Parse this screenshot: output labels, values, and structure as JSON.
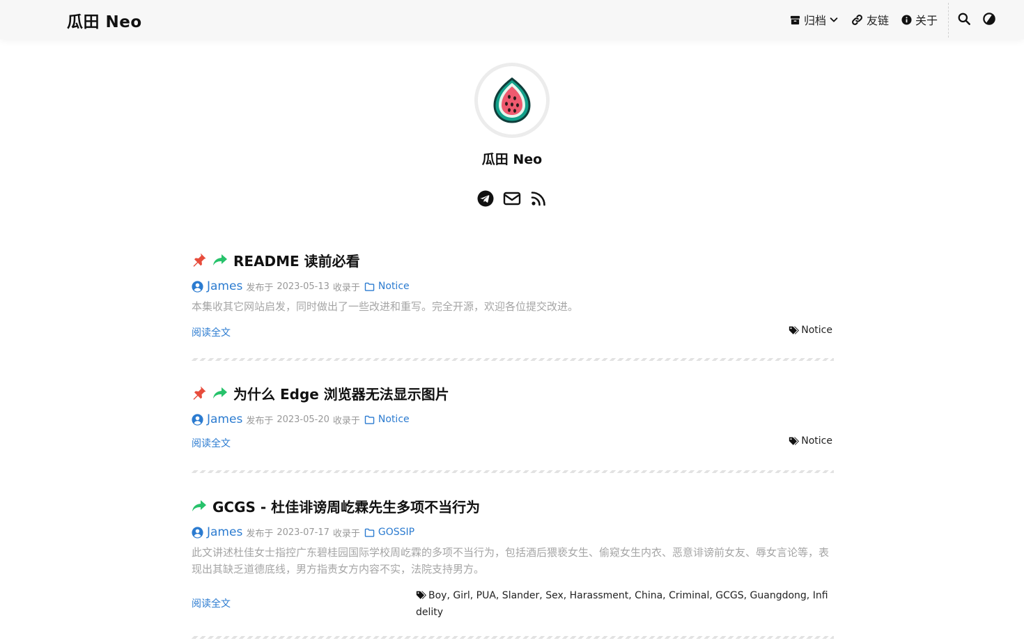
{
  "site": {
    "title": "瓜田 Neo"
  },
  "nav": {
    "archive": "归档",
    "links": "友链",
    "about": "关于"
  },
  "profile": {
    "name": "瓜田 Neo"
  },
  "colors": {
    "accent": "#2b7bd0",
    "pin": "#e74c3c",
    "share": "#27c26b",
    "muted": "#999999"
  },
  "posts": [
    {
      "title": "README 读前必看",
      "author": "James",
      "published_prefix": "发布于",
      "date": "2023-05-13",
      "filed_prefix": "收录于",
      "category": "Notice",
      "excerpt": "本集收其它网站启发，同时做出了一些改进和重写。完全开源，欢迎各位提交改进。",
      "read_more": "阅读全文",
      "tags": "Notice"
    },
    {
      "title": "为什么 Edge 浏览器无法显示图片",
      "author": "James",
      "published_prefix": "发布于",
      "date": "2023-05-20",
      "filed_prefix": "收录于",
      "category": "Notice",
      "read_more": "阅读全文",
      "tags": "Notice"
    },
    {
      "title": "GCGS - 杜佳诽谤周屹霖先生多项不当行为",
      "author": "James",
      "published_prefix": "发布于",
      "date": "2023-07-17",
      "filed_prefix": "收录于",
      "category": "GOSSIP",
      "excerpt": "此文讲述杜佳女士指控广东碧桂园国际学校周屹霖的多项不当行为，包括酒后猥亵女生、偷窥女生内衣、恶意诽谤前女友、辱女言论等，表现出其缺乏道德底线，男方指责女方内容不实，法院支持男方。",
      "read_more": "阅读全文",
      "tags": "Boy, Girl, PUA, Slander, Sex, Harassment, China, Criminal, GCGS, Guangdong, Infidelity"
    }
  ]
}
